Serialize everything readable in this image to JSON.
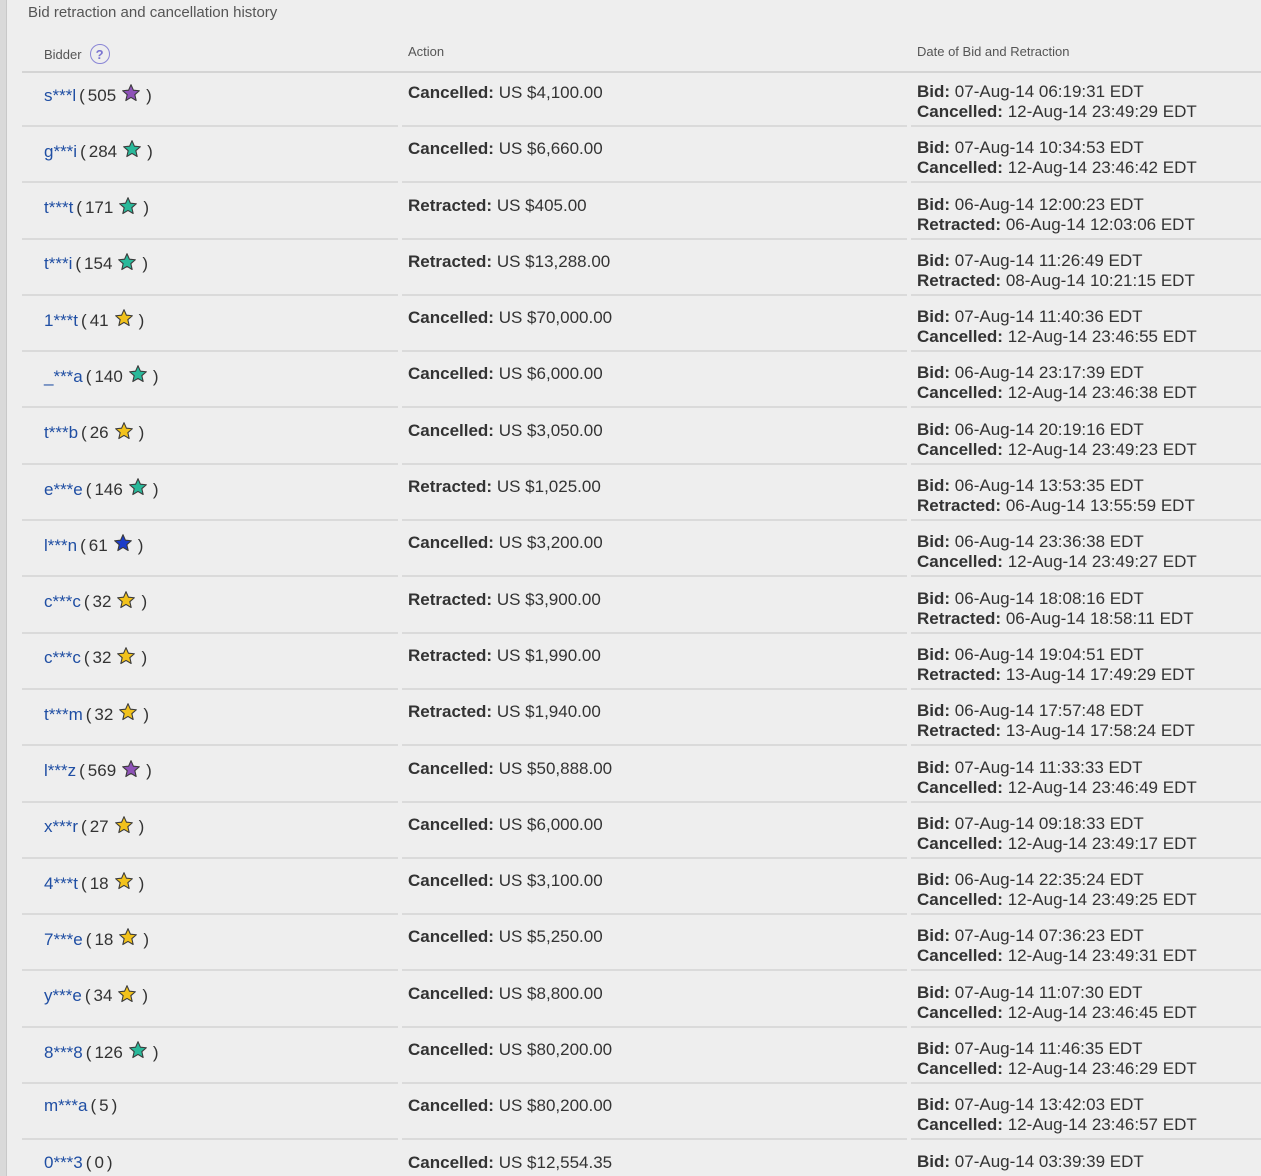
{
  "section_title": "Bid retraction and cancellation history",
  "headers": {
    "bidder": "Bidder",
    "action": "Action",
    "date": "Date of Bid and Retraction",
    "help_glyph": "?"
  },
  "colors": {
    "purple_star": "#8e52b8",
    "teal_star": "#29b99a",
    "yellow_star": "#f2c21b",
    "blue_star": "#1b3cc8",
    "link": "#1f4ea3"
  },
  "rows": [
    {
      "bidder": "s***l",
      "score": "505",
      "star": "purple",
      "action_label": "Cancelled:",
      "amount": "US $4,100.00",
      "bid_label": "Bid:",
      "bid_date": "07-Aug-14 06:19:31 EDT",
      "second_label": "Cancelled:",
      "second_date": "12-Aug-14 23:49:29 EDT"
    },
    {
      "bidder": "g***i",
      "score": "284",
      "star": "teal",
      "action_label": "Cancelled:",
      "amount": "US $6,660.00",
      "bid_label": "Bid:",
      "bid_date": "07-Aug-14 10:34:53 EDT",
      "second_label": "Cancelled:",
      "second_date": "12-Aug-14 23:46:42 EDT"
    },
    {
      "bidder": "t***t",
      "score": "171",
      "star": "teal",
      "action_label": "Retracted:",
      "amount": "US $405.00",
      "bid_label": "Bid:",
      "bid_date": "06-Aug-14 12:00:23 EDT",
      "second_label": "Retracted:",
      "second_date": "06-Aug-14 12:03:06 EDT"
    },
    {
      "bidder": "t***i",
      "score": "154",
      "star": "teal",
      "action_label": "Retracted:",
      "amount": "US $13,288.00",
      "bid_label": "Bid:",
      "bid_date": "07-Aug-14 11:26:49 EDT",
      "second_label": "Retracted:",
      "second_date": "08-Aug-14 10:21:15 EDT"
    },
    {
      "bidder": "1***t",
      "score": "41",
      "star": "yellow",
      "action_label": "Cancelled:",
      "amount": "US $70,000.00",
      "bid_label": "Bid:",
      "bid_date": "07-Aug-14 11:40:36 EDT",
      "second_label": "Cancelled:",
      "second_date": "12-Aug-14 23:46:55 EDT"
    },
    {
      "bidder": "_***a",
      "score": "140",
      "star": "teal",
      "action_label": "Cancelled:",
      "amount": "US $6,000.00",
      "bid_label": "Bid:",
      "bid_date": "06-Aug-14 23:17:39 EDT",
      "second_label": "Cancelled:",
      "second_date": "12-Aug-14 23:46:38 EDT"
    },
    {
      "bidder": "t***b",
      "score": "26",
      "star": "yellow",
      "action_label": "Cancelled:",
      "amount": "US $3,050.00",
      "bid_label": "Bid:",
      "bid_date": "06-Aug-14 20:19:16 EDT",
      "second_label": "Cancelled:",
      "second_date": "12-Aug-14 23:49:23 EDT"
    },
    {
      "bidder": "e***e",
      "score": "146",
      "star": "teal",
      "action_label": "Retracted:",
      "amount": "US $1,025.00",
      "bid_label": "Bid:",
      "bid_date": "06-Aug-14 13:53:35 EDT",
      "second_label": "Retracted:",
      "second_date": "06-Aug-14 13:55:59 EDT"
    },
    {
      "bidder": "l***n",
      "score": "61",
      "star": "blue",
      "action_label": "Cancelled:",
      "amount": "US $3,200.00",
      "bid_label": "Bid:",
      "bid_date": "06-Aug-14 23:36:38 EDT",
      "second_label": "Cancelled:",
      "second_date": "12-Aug-14 23:49:27 EDT"
    },
    {
      "bidder": "c***c",
      "score": "32",
      "star": "yellow",
      "action_label": "Retracted:",
      "amount": "US $3,900.00",
      "bid_label": "Bid:",
      "bid_date": "06-Aug-14 18:08:16 EDT",
      "second_label": "Retracted:",
      "second_date": "06-Aug-14 18:58:11 EDT"
    },
    {
      "bidder": "c***c",
      "score": "32",
      "star": "yellow",
      "action_label": "Retracted:",
      "amount": "US $1,990.00",
      "bid_label": "Bid:",
      "bid_date": "06-Aug-14 19:04:51 EDT",
      "second_label": "Retracted:",
      "second_date": "13-Aug-14 17:49:29 EDT"
    },
    {
      "bidder": "t***m",
      "score": "32",
      "star": "yellow",
      "action_label": "Retracted:",
      "amount": "US $1,940.00",
      "bid_label": "Bid:",
      "bid_date": "06-Aug-14 17:57:48 EDT",
      "second_label": "Retracted:",
      "second_date": "13-Aug-14 17:58:24 EDT"
    },
    {
      "bidder": "l***z",
      "score": "569",
      "star": "purple",
      "action_label": "Cancelled:",
      "amount": "US $50,888.00",
      "bid_label": "Bid:",
      "bid_date": "07-Aug-14 11:33:33 EDT",
      "second_label": "Cancelled:",
      "second_date": "12-Aug-14 23:46:49 EDT"
    },
    {
      "bidder": "x***r",
      "score": "27",
      "star": "yellow",
      "action_label": "Cancelled:",
      "amount": "US $6,000.00",
      "bid_label": "Bid:",
      "bid_date": "07-Aug-14 09:18:33 EDT",
      "second_label": "Cancelled:",
      "second_date": "12-Aug-14 23:49:17 EDT"
    },
    {
      "bidder": "4***t",
      "score": "18",
      "star": "yellow",
      "action_label": "Cancelled:",
      "amount": "US $3,100.00",
      "bid_label": "Bid:",
      "bid_date": "06-Aug-14 22:35:24 EDT",
      "second_label": "Cancelled:",
      "second_date": "12-Aug-14 23:49:25 EDT"
    },
    {
      "bidder": "7***e",
      "score": "18",
      "star": "yellow",
      "action_label": "Cancelled:",
      "amount": "US $5,250.00",
      "bid_label": "Bid:",
      "bid_date": "07-Aug-14 07:36:23 EDT",
      "second_label": "Cancelled:",
      "second_date": "12-Aug-14 23:49:31 EDT"
    },
    {
      "bidder": "y***e",
      "score": "34",
      "star": "yellow",
      "action_label": "Cancelled:",
      "amount": "US $8,800.00",
      "bid_label": "Bid:",
      "bid_date": "07-Aug-14 11:07:30 EDT",
      "second_label": "Cancelled:",
      "second_date": "12-Aug-14 23:46:45 EDT"
    },
    {
      "bidder": "8***8",
      "score": "126",
      "star": "teal",
      "action_label": "Cancelled:",
      "amount": "US $80,200.00",
      "bid_label": "Bid:",
      "bid_date": "07-Aug-14 11:46:35 EDT",
      "second_label": "Cancelled:",
      "second_date": "12-Aug-14 23:46:29 EDT"
    },
    {
      "bidder": "m***a",
      "score": "5",
      "star": "",
      "action_label": "Cancelled:",
      "amount": "US $80,200.00",
      "bid_label": "Bid:",
      "bid_date": "07-Aug-14 13:42:03 EDT",
      "second_label": "Cancelled:",
      "second_date": "12-Aug-14 23:46:57 EDT"
    },
    {
      "bidder": "0***3",
      "score": "0",
      "star": "",
      "action_label": "Cancelled:",
      "amount": "US $12,554.35",
      "bid_label": "Bid:",
      "bid_date": "07-Aug-14 03:39:39 EDT",
      "second_label": "",
      "second_date": ""
    }
  ]
}
